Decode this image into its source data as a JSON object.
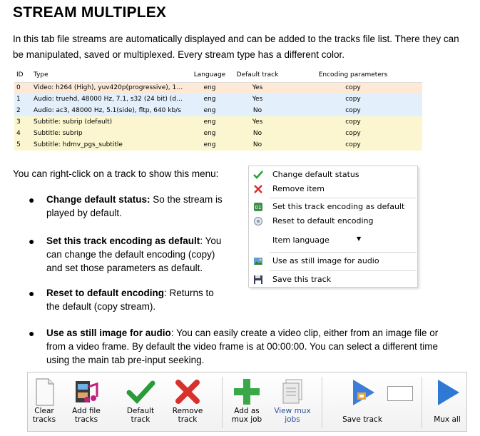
{
  "title": "STREAM MULTIPLEX",
  "intro": "In this tab file streams are automatically displayed and can be added to the tracks file list. There they can be manipulated, saved or multiplexed. Every stream type has a different color.",
  "table": {
    "headers": [
      "ID",
      "Type",
      "Language",
      "Default track",
      "Encoding parameters"
    ],
    "rows": [
      {
        "id": "0",
        "type": "Video: h264 (High), yuv420p(progressive), 19...",
        "lang": "eng",
        "default": "Yes",
        "enc": "copy"
      },
      {
        "id": "1",
        "type": "Audio: truehd, 48000 Hz, 7.1, s32 (24 bit) (de...",
        "lang": "eng",
        "default": "Yes",
        "enc": "copy"
      },
      {
        "id": "2",
        "type": "Audio: ac3, 48000 Hz, 5.1(side), fltp, 640 kb/s",
        "lang": "eng",
        "default": "No",
        "enc": "copy"
      },
      {
        "id": "3",
        "type": "Subtitle: subrip (default)",
        "lang": "eng",
        "default": "Yes",
        "enc": "copy"
      },
      {
        "id": "4",
        "type": "Subtitle: subrip",
        "lang": "eng",
        "default": "No",
        "enc": "copy"
      },
      {
        "id": "5",
        "type": "Subtitle: hdmv_pgs_subtitle",
        "lang": "eng",
        "default": "No",
        "enc": "copy"
      }
    ],
    "colors": {
      "video": "#fde9d6",
      "audio": "#e3f0fb",
      "subtitle": "#fbf6cf"
    }
  },
  "rc_text": "You can right-click on a track to show this menu:",
  "bullets": [
    {
      "bold": "Change default status:",
      "rest": " So the stream is",
      "line2": "played by default."
    },
    {
      "bold": "Set this track encoding as default",
      "rest": ": You",
      "line2": "can change the default encoding (copy)",
      "line3": "and set those parameters as default."
    },
    {
      "bold": "Reset to default encoding",
      "rest": ": Returns to",
      "line2": "the default (copy stream)."
    },
    {
      "bold": "Use as still image for audio",
      "rest": ": You can easily create a video clip, either from an image file or",
      "line2": "from a video frame. By default the video frame is at 00:00:00. You can select a different time",
      "line3": "using the main tab pre-input seeking."
    }
  ],
  "context_menu": {
    "items": [
      {
        "label": "Change default status",
        "icon": "checkmark-icon"
      },
      {
        "label": "Remove item",
        "icon": "red-x-icon"
      },
      {
        "label": "Set this track encoding as default",
        "icon": "encoding-icon"
      },
      {
        "label": "Reset to default encoding",
        "icon": "reset-icon"
      },
      {
        "label": "Item language",
        "icon": "dropdown-arrow-icon"
      },
      {
        "label": "Use as still image for audio",
        "icon": "image-icon"
      },
      {
        "label": "Save this track",
        "icon": "floppy-disk-icon"
      }
    ]
  },
  "toolbar": {
    "buttons": [
      {
        "l1": "Clear",
        "l2": "tracks",
        "icon": "document-icon"
      },
      {
        "l1": "Add file",
        "l2": "tracks",
        "icon": "film-music-icon"
      },
      {
        "l1": "Default",
        "l2": "track",
        "icon": "green-check-icon"
      },
      {
        "l1": "Remove",
        "l2": "track",
        "icon": "red-x-icon"
      },
      {
        "l1": "Add as",
        "l2": "mux job",
        "icon": "green-plus-icon"
      },
      {
        "l1": "View mux",
        "l2": "jobs",
        "icon": "documents-icon"
      },
      {
        "l1": "Save track",
        "l2": "",
        "icon": "save-track-icon"
      },
      {
        "l1": "Mux all",
        "l2": "",
        "icon": "play-icon"
      }
    ]
  }
}
